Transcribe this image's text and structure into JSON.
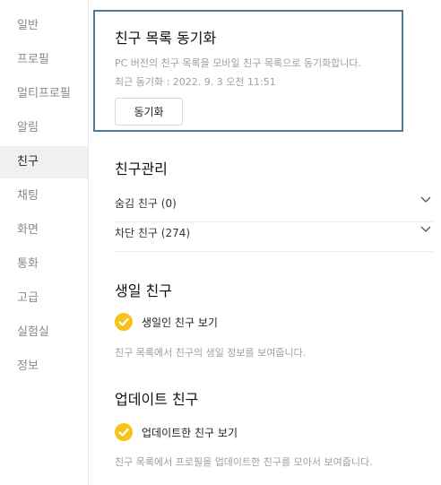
{
  "sidebar": {
    "items": [
      {
        "label": "일반"
      },
      {
        "label": "프로필"
      },
      {
        "label": "멀티프로필"
      },
      {
        "label": "알림"
      },
      {
        "label": "친구"
      },
      {
        "label": "채팅"
      },
      {
        "label": "화면"
      },
      {
        "label": "통화"
      },
      {
        "label": "고급"
      },
      {
        "label": "실험실"
      },
      {
        "label": "정보"
      }
    ],
    "active": "친구"
  },
  "sync": {
    "title": "친구 목록 동기화",
    "description": "PC 버전의 친구 목록을 모바일 친구 목록으로 동기화합니다.",
    "last_sync": "최근 동기화 : 2022. 9. 3 오전 11:51",
    "button_label": "동기화"
  },
  "friend_manage": {
    "title": "친구관리",
    "hidden_label": "숨김 친구 (0)",
    "blocked_label": "차단 친구 (274)"
  },
  "birthday": {
    "title": "생일 친구",
    "checkbox_label": "생일인 친구 보기",
    "checked": true,
    "hint": "친구 목록에서 친구의 생일 정보를 보여줍니다."
  },
  "updated": {
    "title": "업데이트 친구",
    "checkbox_label": "업데이트한 친구 보기",
    "checked": true,
    "hint": "친구 목록에서 프로필을 업데이트한 친구를 모아서 보여줍니다."
  },
  "colors": {
    "accent_check": "#f7c31a",
    "focus_border": "#4d7a99",
    "active_bg": "#f0f0f0"
  }
}
